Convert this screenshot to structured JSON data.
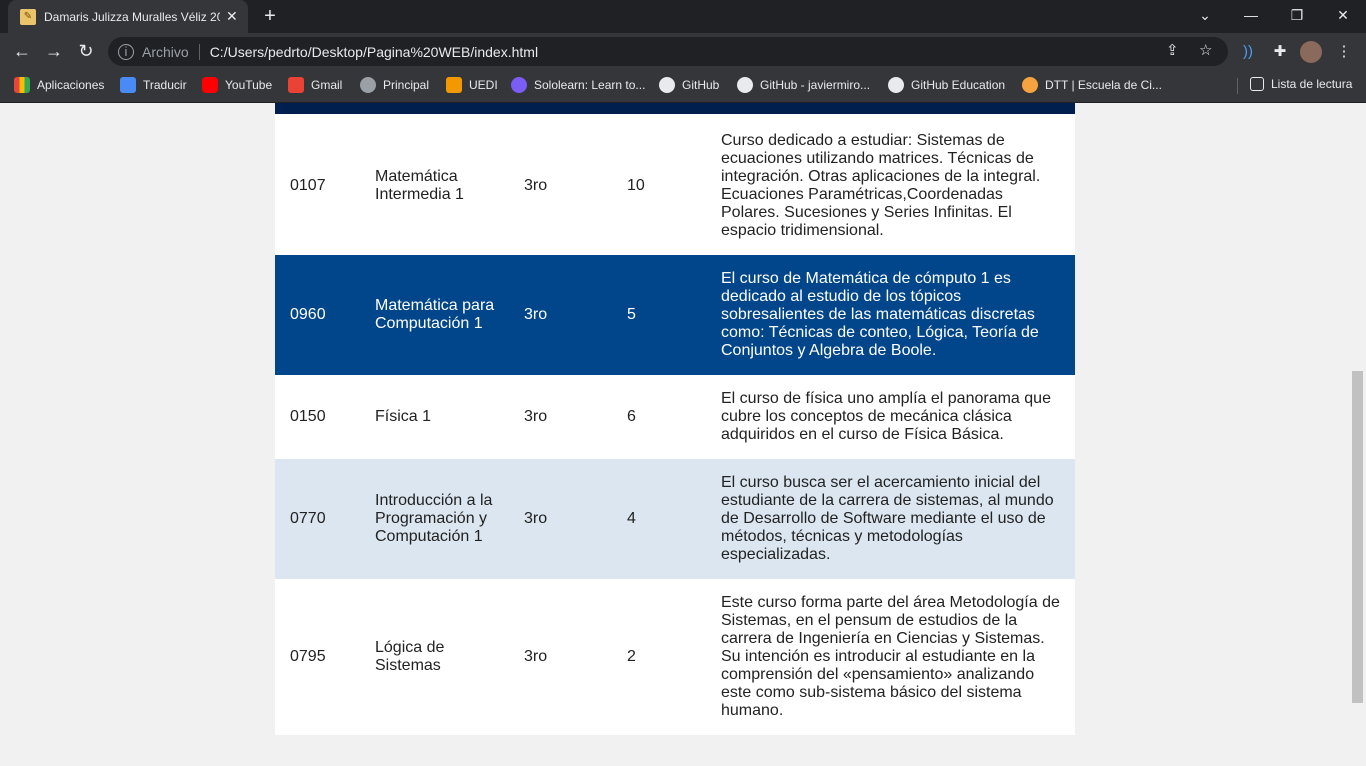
{
  "browser": {
    "tab_title": "Damaris Julizza Muralles Véliz 20",
    "tab_close": "✕",
    "new_tab": "+",
    "address_label": "Archivo",
    "url": "C:/Users/pedrto/Desktop/Pagina%20WEB/index.html",
    "bookmarks": [
      {
        "label": "Aplicaciones",
        "icon": "apps-grid-icon",
        "color": "#e8453c"
      },
      {
        "label": "Traducir",
        "icon": "translate-icon",
        "color": "#4a8af4"
      },
      {
        "label": "YouTube",
        "icon": "youtube-icon",
        "color": "#ff0000"
      },
      {
        "label": "Gmail",
        "icon": "gmail-icon",
        "color": "#ea4335"
      },
      {
        "label": "Principal",
        "icon": "globe-icon",
        "color": "#9aa0a6"
      },
      {
        "label": "UEDI",
        "icon": "uedi-icon",
        "color": "#f29900"
      },
      {
        "label": "Sololearn: Learn to...",
        "icon": "sololearn-icon",
        "color": "#7b5cf5"
      },
      {
        "label": "GitHub",
        "icon": "github-icon",
        "color": "#e8eaed"
      },
      {
        "label": "GitHub - javiermiro...",
        "icon": "github-icon",
        "color": "#e8eaed"
      },
      {
        "label": "GitHub Education",
        "icon": "github-icon",
        "color": "#e8eaed"
      },
      {
        "label": "DTT | Escuela de Ci...",
        "icon": "dtt-icon",
        "color": "#f4a340"
      }
    ],
    "reading_list": "Lista de lectura"
  },
  "courses": [
    {
      "code": "0107",
      "name": "Matemática Intermedia 1",
      "semester": "3ro",
      "credits": "10",
      "description": "Curso dedicado a estudiar: Sistemas de ecuaciones utilizando matrices. Técnicas de integración. Otras aplicaciones de la integral. Ecuaciones Paramétricas,Coordenadas Polares. Sucesiones y Series Infinitas. El espacio tridimensional.",
      "style": "white"
    },
    {
      "code": "0960",
      "name": "Matemática para Computación 1",
      "semester": "3ro",
      "credits": "5",
      "description": "El curso de Matemática de cómputo 1 es dedicado al estudio de los tópicos sobresalientes de las matemáticas discretas como: Técnicas de conteo, Lógica, Teoría de Conjuntos y Algebra de Boole.",
      "style": "blue"
    },
    {
      "code": "0150",
      "name": "Física 1",
      "semester": "3ro",
      "credits": "6",
      "description": "El curso de física uno amplía el panorama que cubre los conceptos de mecánica clásica adquiridos en el curso de Física Básica.",
      "style": "white"
    },
    {
      "code": "0770",
      "name": "Introducción a la Programación y Computación 1",
      "semester": "3ro",
      "credits": "4",
      "description": "El curso busca ser el acercamiento inicial del estudiante de la carrera de sistemas, al mundo de Desarrollo de Software mediante el uso de métodos, técnicas y metodologías especializadas.",
      "style": "light"
    },
    {
      "code": "0795",
      "name": "Lógica de Sistemas",
      "semester": "3ro",
      "credits": "2",
      "description": "Este curso forma parte del área Metodología de Sistemas, en el pensum de estudios de la carrera de Ingeniería en Ciencias y Sistemas. Su intención es introducir al estudiante en la comprensión del «pensamiento» analizando este como sub-sistema básico del sistema humano.",
      "style": "white"
    }
  ]
}
